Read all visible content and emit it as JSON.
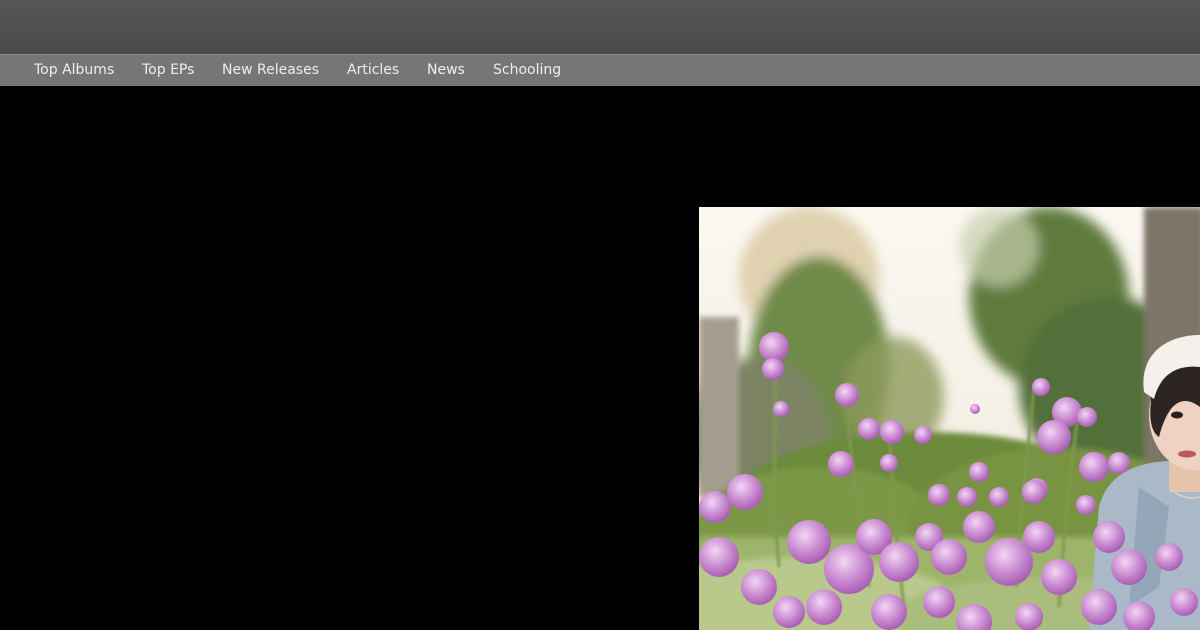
{
  "header": {},
  "nav": {
    "items": [
      {
        "label": "Top Albums"
      },
      {
        "label": "Top EPs"
      },
      {
        "label": "New Releases"
      },
      {
        "label": "Articles"
      },
      {
        "label": "News"
      },
      {
        "label": "Schooling"
      }
    ]
  },
  "hero": {
    "image": "photo of a woman in a white beanie among purple globe amaranth flowers",
    "colors": {
      "page_background": "#000000",
      "header_background": "#4f4f4f",
      "nav_background": "#767676",
      "nav_text": "#eeeeee"
    }
  }
}
